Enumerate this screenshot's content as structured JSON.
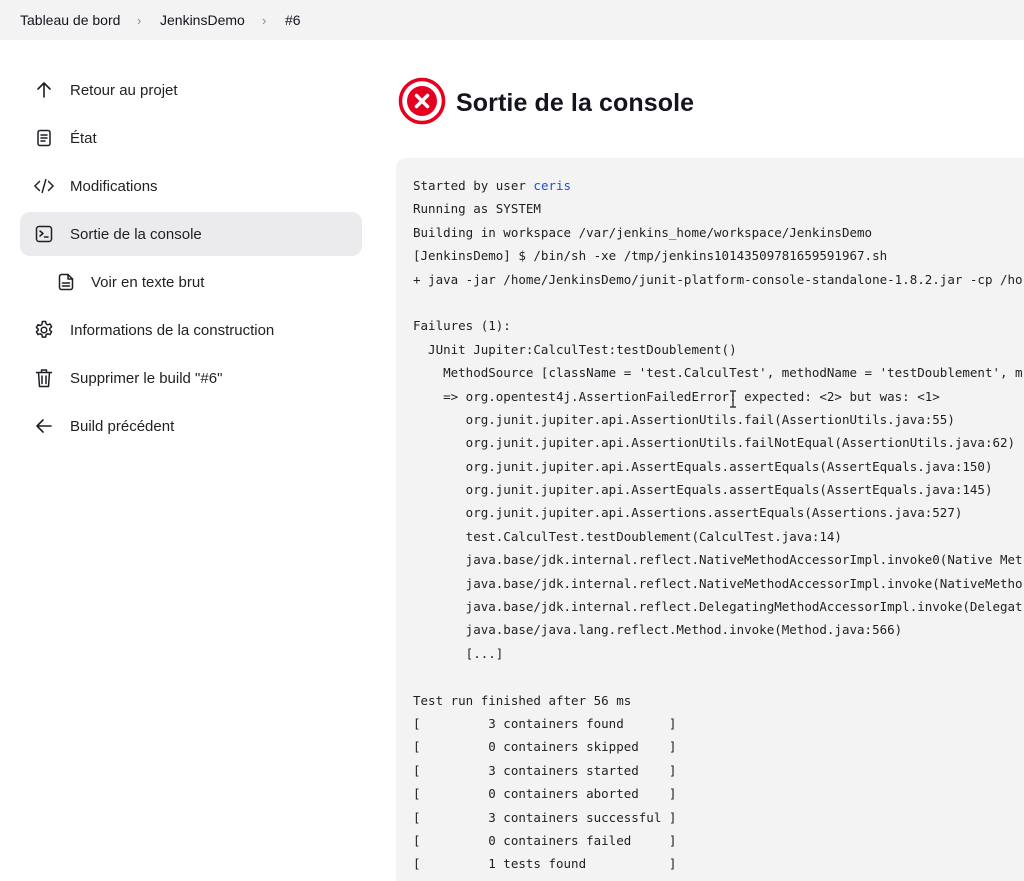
{
  "breadcrumb": {
    "items": [
      "Tableau de bord",
      "JenkinsDemo",
      "#6"
    ],
    "separator": "›"
  },
  "sidebar": {
    "items": [
      {
        "label": "Retour au projet",
        "icon": "arrow-up-icon"
      },
      {
        "label": "État",
        "icon": "document-icon"
      },
      {
        "label": "Modifications",
        "icon": "code-icon"
      },
      {
        "label": "Sortie de la console",
        "icon": "terminal-icon",
        "active": true
      },
      {
        "label": "Voir en texte brut",
        "icon": "file-text-icon",
        "sub": true
      },
      {
        "label": "Informations de la construction",
        "icon": "gear-icon"
      },
      {
        "label": "Supprimer le build \"#6\"",
        "icon": "trash-icon"
      },
      {
        "label": "Build précédent",
        "icon": "arrow-left-icon"
      }
    ]
  },
  "main": {
    "title": "Sortie de la console",
    "status_icon": "failure-icon",
    "status_color": "#e6001f"
  },
  "console": {
    "first_line_prefix": "Started by user ",
    "user": "ceris",
    "lines": [
      "Running as SYSTEM",
      "Building in workspace /var/jenkins_home/workspace/JenkinsDemo",
      "[JenkinsDemo] $ /bin/sh -xe /tmp/jenkins10143509781659591967.sh",
      "+ java -jar /home/JenkinsDemo/junit-platform-console-standalone-1.8.2.jar -cp /ho",
      "",
      "Failures (1):",
      "  JUnit Jupiter:CalculTest:testDoublement()",
      "    MethodSource [className = 'test.CalculTest', methodName = 'testDoublement', m",
      "    => org.opentest4j.AssertionFailedError: expected: <2> but was: <1>",
      "       org.junit.jupiter.api.AssertionUtils.fail(AssertionUtils.java:55)",
      "       org.junit.jupiter.api.AssertionUtils.failNotEqual(AssertionUtils.java:62)",
      "       org.junit.jupiter.api.AssertEquals.assertEquals(AssertEquals.java:150)",
      "       org.junit.jupiter.api.AssertEquals.assertEquals(AssertEquals.java:145)",
      "       org.junit.jupiter.api.Assertions.assertEquals(Assertions.java:527)",
      "       test.CalculTest.testDoublement(CalculTest.java:14)",
      "       java.base/jdk.internal.reflect.NativeMethodAccessorImpl.invoke0(Native Met",
      "       java.base/jdk.internal.reflect.NativeMethodAccessorImpl.invoke(NativeMetho",
      "       java.base/jdk.internal.reflect.DelegatingMethodAccessorImpl.invoke(Delegat",
      "       java.base/java.lang.reflect.Method.invoke(Method.java:566)",
      "       [...]",
      "",
      "Test run finished after 56 ms",
      "[         3 containers found      ]",
      "[         0 containers skipped    ]",
      "[         3 containers started    ]",
      "[         0 containers aborted    ]",
      "[         3 containers successful ]",
      "[         0 containers failed     ]",
      "[         1 tests found           ]"
    ]
  },
  "colors": {
    "accent_link": "#1f4fd1",
    "active_bg": "#ebebed",
    "console_bg": "#f3f3f4"
  }
}
